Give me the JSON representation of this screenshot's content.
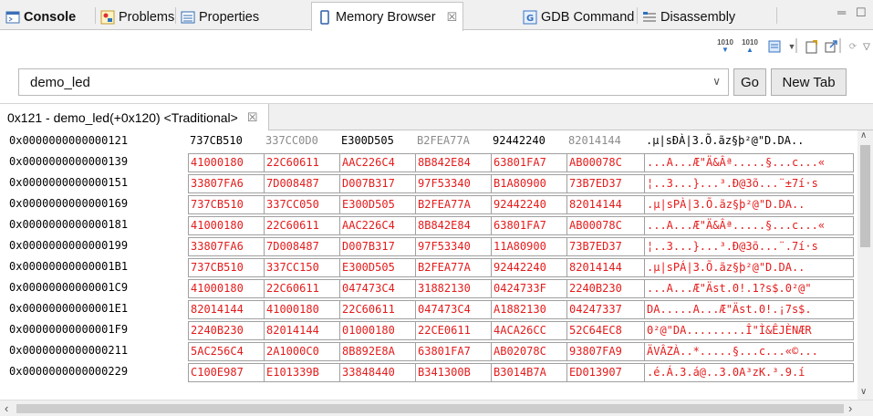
{
  "tabs": [
    {
      "label": "Console",
      "icon": "console-icon"
    },
    {
      "label": "Problems",
      "icon": "problems-icon"
    },
    {
      "label": "Properties",
      "icon": "properties-icon"
    },
    {
      "label": "Memory Browser",
      "icon": "memory-icon",
      "close": "☒"
    },
    {
      "label": "GDB Command",
      "icon": "gdb-icon"
    },
    {
      "label": "Disassembly",
      "icon": "disassembly-icon"
    }
  ],
  "toolbar": {
    "icon1_text": "1010",
    "icon2_text": "1010"
  },
  "address_input": {
    "value": "demo_led"
  },
  "buttons": {
    "go": "Go",
    "new_tab": "New Tab"
  },
  "rendering_tab": {
    "label": "0x121 - demo_led(+0x120) <Traditional>",
    "close": "☒"
  },
  "colors": {
    "changed": "#e41b1b",
    "unchanged": "#8c8c8c"
  },
  "memory": {
    "rows": [
      {
        "address": "0x0000000000000121",
        "words": [
          "737CB510",
          "337CC0D0",
          "E300D505",
          "B2FEA77A",
          "92442240",
          "82014144"
        ],
        "ascii": ".µ|sÐÀ|3.Õ.ãz§þ²@\"D.DA.."
      },
      {
        "address": "0x0000000000000139",
        "words": [
          "41000180",
          "22C60611",
          "AAC226C4",
          "8B842E84",
          "63801FA7",
          "AB00078C"
        ],
        "ascii": "...A...Æ\"Ä&Âª.....§...c...«"
      },
      {
        "address": "0x0000000000000151",
        "words": [
          "33807FA6",
          "7D008487",
          "D007B317",
          "97F53340",
          "B1A80900",
          "73B7ED37"
        ],
        "ascii": "¦..3...}...³.Ð@3õ...¨±7í·s"
      },
      {
        "address": "0x0000000000000169",
        "words": [
          "737CB510",
          "337CC050",
          "E300D505",
          "B2FEA77A",
          "92442240",
          "82014144"
        ],
        "ascii": ".µ|sPÀ|3.Õ.ãz§þ²@\"D.DA.."
      },
      {
        "address": "0x0000000000000181",
        "words": [
          "41000180",
          "22C60611",
          "AAC226C4",
          "8B842E84",
          "63801FA7",
          "AB00078C"
        ],
        "ascii": "...A...Æ\"Ä&Âª.....§...c...«"
      },
      {
        "address": "0x0000000000000199",
        "words": [
          "33807FA6",
          "7D008487",
          "D007B317",
          "97F53340",
          "11A80900",
          "73B7ED37"
        ],
        "ascii": "¦..3...}...³.Ð@3õ...¨.7í·s"
      },
      {
        "address": "0x00000000000001B1",
        "words": [
          "737CB510",
          "337CC150",
          "E300D505",
          "B2FEA77A",
          "92442240",
          "82014144"
        ],
        "ascii": ".µ|sPÁ|3.Õ.ãz§þ²@\"D.DA.."
      },
      {
        "address": "0x00000000000001C9",
        "words": [
          "41000180",
          "22C60611",
          "047473C4",
          "31882130",
          "0424733F",
          "2240B230"
        ],
        "ascii": "...A...Æ\"Äst.0!.1?s$.0²@\""
      },
      {
        "address": "0x00000000000001E1",
        "words": [
          "82014144",
          "41000180",
          "22C60611",
          "047473C4",
          "A1882130",
          "04247337"
        ],
        "ascii": "DA.....A...Æ\"Äst.0!.¡7s$."
      },
      {
        "address": "0x00000000000001F9",
        "words": [
          "2240B230",
          "82014144",
          "01000180",
          "22CE0611",
          "4ACA26CC",
          "52C64EC8"
        ],
        "ascii": "0²@\"DA.........Î\"Ì&ÊJÈNÆR"
      },
      {
        "address": "0x0000000000000211",
        "words": [
          "5AC256C4",
          "2A1000C0",
          "8B892E8A",
          "63801FA7",
          "AB02078C",
          "93807FA9"
        ],
        "ascii": "ÄVÂZÀ..*.....§...c...«©..."
      },
      {
        "address": "0x0000000000000229",
        "words": [
          "C100E987",
          "E101339B",
          "33848440",
          "B341300B",
          "B3014B7A",
          "ED013907"
        ],
        "ascii": ".é.Á.3.á@..3.0A³zK.³.9.í"
      }
    ]
  }
}
